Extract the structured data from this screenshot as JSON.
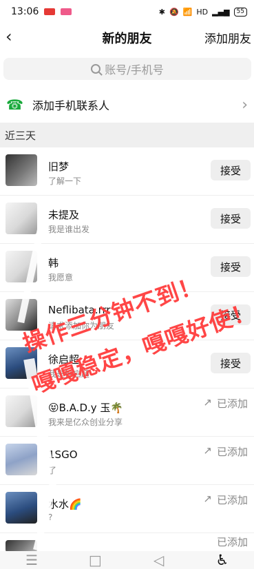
{
  "status": {
    "time": "13:06",
    "right": "HD",
    "battery": "55"
  },
  "header": {
    "back_icon": "chevron-left-icon",
    "title": "新的朋友",
    "add_friend": "添加朋友"
  },
  "search": {
    "placeholder": "账号/手机号"
  },
  "contacts": {
    "label": "添加手机联系人"
  },
  "section": {
    "label": "近三天"
  },
  "rows": [
    {
      "name": "旧梦",
      "subtitle": "了解一下",
      "action": "接受"
    },
    {
      "name": "未提及",
      "subtitle": "我是谁出发",
      "action": "接受"
    },
    {
      "name": "韩",
      "subtitle": "我愿意",
      "action": "接受"
    },
    {
      "name": "Neflibata.rrr",
      "subtitle": "请求添加你为朋友",
      "action": "接受"
    },
    {
      "name": "徐启超",
      "subtitle": "我是徐启超",
      "action": "接受"
    },
    {
      "name": "😝B.A.D.y 玉🌴",
      "subtitle": "我来是亿众创业分享",
      "action": "已添加"
    },
    {
      "name": "1SGO",
      "subtitle": "了",
      "action": "已添加"
    },
    {
      "name": "水水🌈",
      "subtitle": "?",
      "action": "已添加"
    },
    {
      "name": "",
      "subtitle": "",
      "action": "已添加"
    }
  ],
  "watermark": {
    "line1": "操作三分钟不到！",
    "line2": "嘎嘎稳定，嘎嘎好使！"
  },
  "bottom_nav": {
    "menu_icon": "menu-icon",
    "home_icon": "home-icon",
    "back_icon": "back-triangle-icon",
    "accessibility_icon": "accessibility-icon"
  },
  "colors": {
    "watermark": "#ff3d3d",
    "phone_green": "#1aaa3c"
  }
}
